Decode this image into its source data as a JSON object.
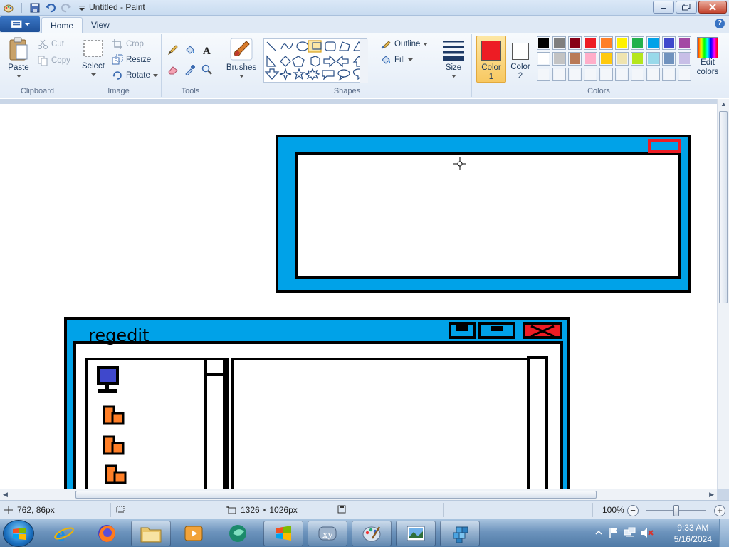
{
  "window": {
    "title": "Untitled - Paint"
  },
  "tabs": [
    {
      "label": "Home"
    },
    {
      "label": "View"
    }
  ],
  "ribbon": {
    "clipboard": {
      "paste": "Paste",
      "cut": "Cut",
      "copy": "Copy",
      "group": "Clipboard"
    },
    "image": {
      "select": "Select",
      "crop": "Crop",
      "resize": "Resize",
      "rotate": "Rotate",
      "group": "Image"
    },
    "tools": {
      "group": "Tools",
      "items": [
        "pencil",
        "fill",
        "text",
        "eraser",
        "color-picker",
        "magnifier"
      ]
    },
    "brushes": {
      "label": "Brushes"
    },
    "shapes": {
      "group": "Shapes",
      "outline": "Outline",
      "fill": "Fill"
    },
    "size": {
      "label": "Size"
    },
    "color1": {
      "label": "Color 1",
      "line1": "Color",
      "line2": "1",
      "value": "#ed1c24"
    },
    "color2": {
      "label": "Color 2",
      "line1": "Color",
      "line2": "2",
      "value": "#ffffff"
    },
    "colors": {
      "group": "Colors",
      "edit": "Edit colors",
      "edit_line1": "Edit",
      "edit_line2": "colors",
      "row1": [
        "#000000",
        "#7f7f7f",
        "#880015",
        "#ed1c24",
        "#ff7f27",
        "#fff200",
        "#22b14c",
        "#00a2e8",
        "#3f48cc",
        "#a349a4"
      ],
      "row2": [
        "#ffffff",
        "#c3c3c3",
        "#b97a57",
        "#ffaec9",
        "#ffc90e",
        "#efe4b0",
        "#b5e61d",
        "#99d9ea",
        "#7092be",
        "#c8bfe7"
      ],
      "row3": [
        "#f3f6fa",
        "#f3f6fa",
        "#f3f6fa",
        "#f3f6fa",
        "#f3f6fa",
        "#f3f6fa",
        "#f3f6fa",
        "#f3f6fa",
        "#f3f6fa",
        "#f3f6fa"
      ]
    }
  },
  "canvas_drawing": {
    "regedit_title": "regedit"
  },
  "statusbar": {
    "cursor_pos": "762, 86px",
    "image_size": "1326 × 1026px",
    "zoom": "100%"
  },
  "taskbar": {
    "time": "9:33 AM",
    "date": "5/16/2024"
  }
}
